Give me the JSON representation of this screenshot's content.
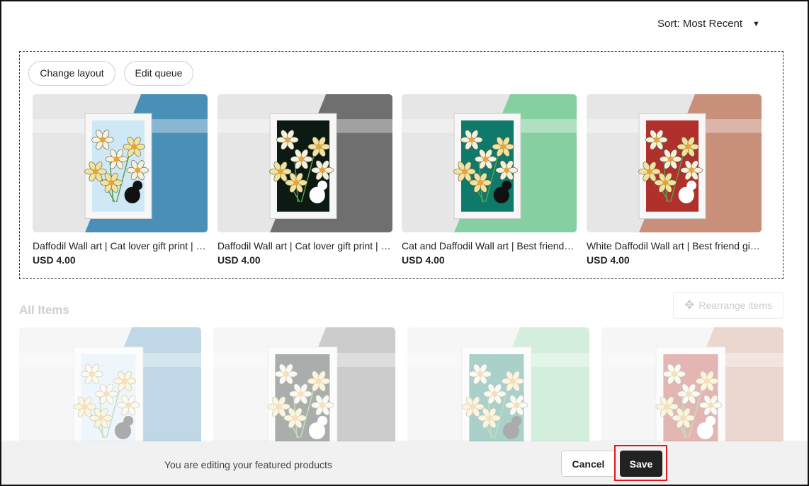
{
  "sort": {
    "label": "Sort: Most Recent"
  },
  "featured": {
    "change_layout_label": "Change layout",
    "edit_queue_label": "Edit queue",
    "products": [
      {
        "title": "Daffodil Wall art | Cat lover gift print | Instant download",
        "price": "USD 4.00",
        "accent": "#4a8fb8",
        "paper": "#cfe8f6",
        "cat": "#111111"
      },
      {
        "title": "Daffodil Wall art | Cat lover gift print | Printable",
        "price": "USD 4.00",
        "accent": "#6f6f6f",
        "paper": "#0d1a14",
        "cat": "#ffffff"
      },
      {
        "title": "Cat and Daffodil Wall art | Best friend gift",
        "price": "USD 4.00",
        "accent": "#86cfa0",
        "paper": "#0f7a6a",
        "cat": "#111111"
      },
      {
        "title": "White Daffodil Wall art | Best friend gift print",
        "price": "USD 4.00",
        "accent": "#c88f7a",
        "paper": "#b0302c",
        "cat": "#ffffff"
      }
    ]
  },
  "all_items": {
    "title": "All Items",
    "rearrange_label": "Rearrange items"
  },
  "bottom_bar": {
    "message": "You are editing your featured products",
    "cancel_label": "Cancel",
    "save_label": "Save"
  },
  "colors": {
    "save_highlight": "#e0161e",
    "save_bg": "#222222",
    "bar_bg": "#f1f1f1"
  }
}
